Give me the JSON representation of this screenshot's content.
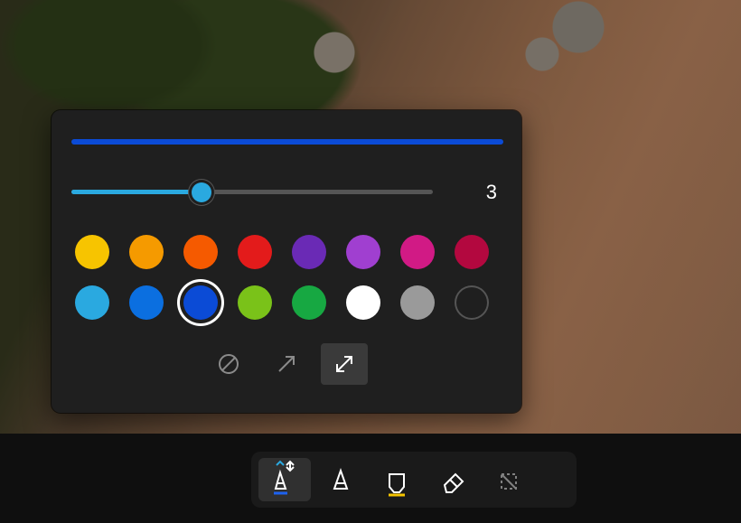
{
  "stroke": {
    "preview_color": "#0b4bd6",
    "width_value": "3",
    "slider_percent": 36,
    "slider_accent": "#2aa9e0"
  },
  "palette": {
    "row1": [
      "#f7c400",
      "#f59a00",
      "#f55a00",
      "#e31b1b",
      "#6a2ab5",
      "#a03fd0",
      "#d11a85",
      "#b3083f"
    ],
    "row2": [
      "#2aa9e0",
      "#0b6fe0",
      "#0b4bd6",
      "#7ac219",
      "#17a842",
      "#ffffff",
      "#9a9a9a",
      "none"
    ],
    "selected": "#0b4bd6"
  },
  "tips": {
    "items": [
      "no-tip",
      "single-arrow",
      "double-arrow"
    ],
    "selected": "double-arrow"
  },
  "toolbar": {
    "tools": [
      "marker-blue",
      "marker-plain",
      "marker-yellow",
      "eraser",
      "crop"
    ],
    "active": "marker-blue"
  }
}
